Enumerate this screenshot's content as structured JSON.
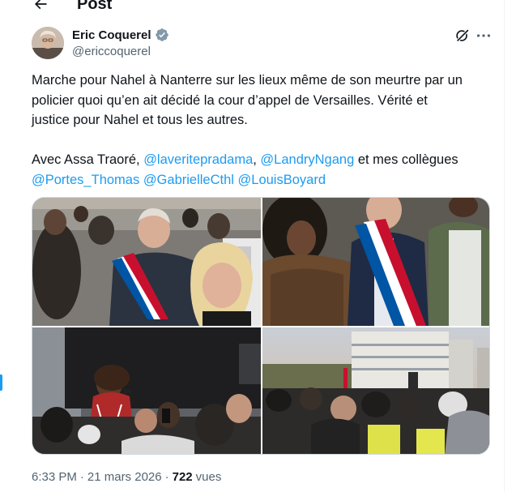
{
  "header": {
    "title": "Post"
  },
  "author": {
    "name": "Eric Coquerel",
    "handle": "@ericcoquerel"
  },
  "tweet": {
    "line1": "Marche pour Nahel à Nanterre sur les lieux même de son meurtre par un",
    "line2": "policier quoi qu’en ait décidé la cour d’appel de Versailles. Vérité et",
    "line3": "justice  pour Nahel et tous les autres.",
    "avec_prefix": "Avec Assa Traoré, ",
    "mention1": "@laveritepradama",
    "sep1": ", ",
    "mention2": "@LandryNgang",
    "avec_suffix": " et mes collègues",
    "mention3": "@Portes_Thomas",
    "mention4": "@GabrielleCthl",
    "mention5": "@LouisBoyard"
  },
  "meta": {
    "time": "6:33 PM",
    "sep": " · ",
    "date": "21 mars 2026",
    "sep2": " · ",
    "views_count": "722",
    "views_label": "vues"
  },
  "colors": {
    "accent": "#1d9bf0",
    "text": "#0f1419",
    "secondary": "#536471",
    "border": "#cfd9de"
  },
  "icons": {
    "back": "arrow-left-icon",
    "verified": "verified-badge-icon",
    "grok": "grok-icon",
    "more": "more-horizontal-icon"
  }
}
